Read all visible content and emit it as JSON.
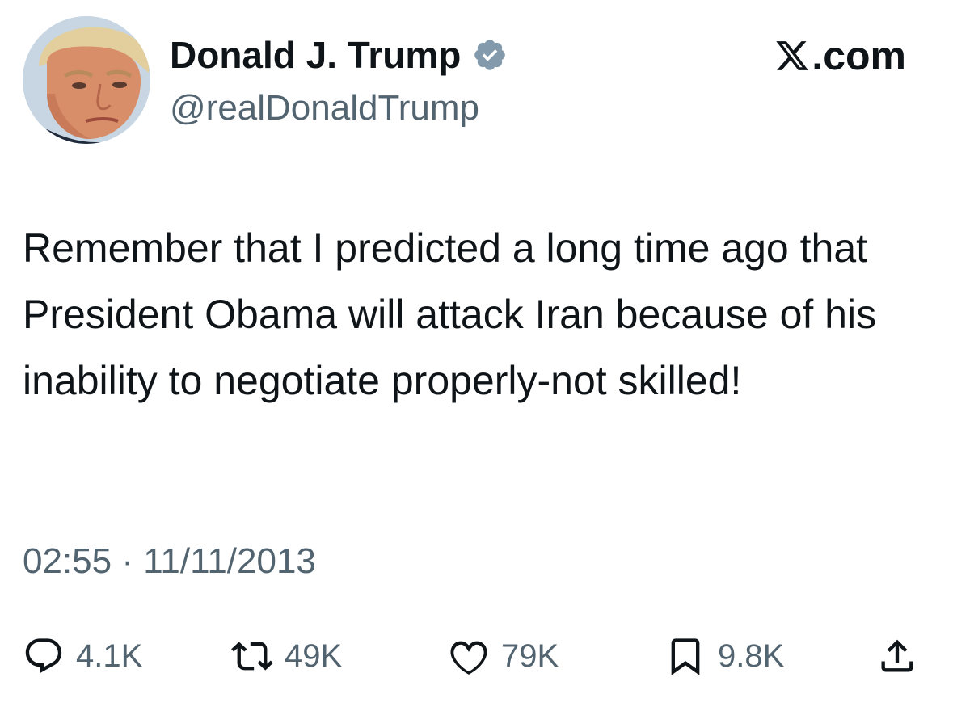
{
  "tweet": {
    "author": {
      "display_name": "Donald J. Trump",
      "handle": "@realDonaldTrump",
      "verified": true
    },
    "brand": ".com",
    "text": "Remember that I predicted a long time ago that President Obama will attack Iran because of his inability to negotiate properly-not skilled!",
    "timestamp": "02:55 · 11/11/2013",
    "stats": {
      "replies": "4.1K",
      "reposts": "49K",
      "likes": "79K",
      "bookmarks": "9.8K"
    }
  },
  "icons": [
    "avatar-photo",
    "verified-badge-icon",
    "x-logo-icon",
    "reply-icon",
    "repost-icon",
    "like-icon",
    "bookmark-icon",
    "share-icon"
  ],
  "colors": {
    "text": "#0f1419",
    "secondary": "#536471",
    "verified_badge": "#829aab",
    "background": "#ffffff"
  }
}
